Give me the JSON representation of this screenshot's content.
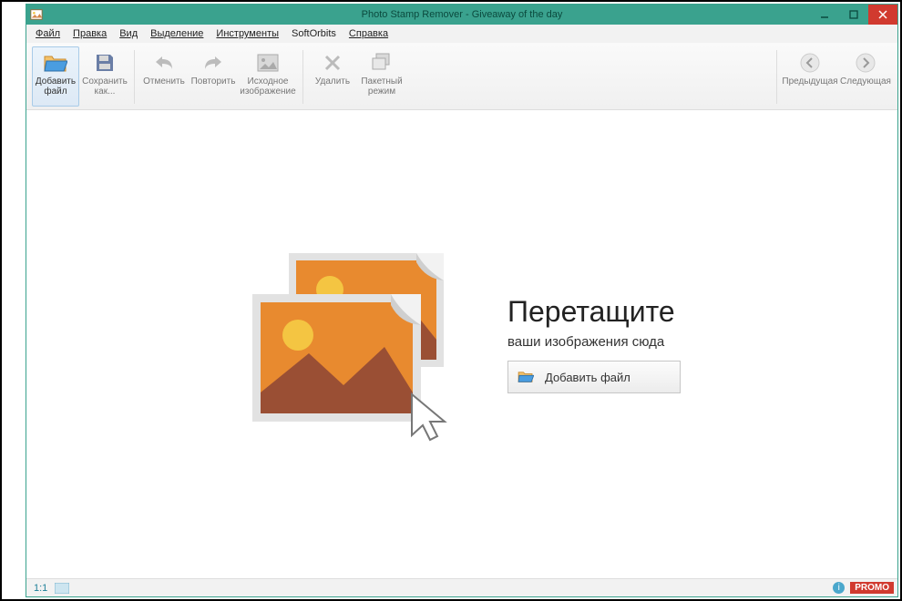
{
  "window": {
    "title": "Photo Stamp Remover - Giveaway of the day"
  },
  "menu": {
    "file": "Файл",
    "edit": "Правка",
    "view": "Вид",
    "selection": "Выделение",
    "tools": "Инструменты",
    "softorbits": "SoftOrbits",
    "help": "Справка"
  },
  "toolbar": {
    "add_file_l1": "Добавить",
    "add_file_l2": "файл",
    "save_as_l1": "Сохранить",
    "save_as_l2": "как...",
    "undo": "Отменить",
    "redo": "Повторить",
    "original_l1": "Исходное",
    "original_l2": "изображение",
    "delete": "Удалить",
    "batch_l1": "Пакетный",
    "batch_l2": "режим",
    "prev": "Предыдущая",
    "next": "Следующая"
  },
  "drop": {
    "title": "Перетащите",
    "subtitle": "ваши изображения сюда",
    "button": "Добавить файл"
  },
  "status": {
    "zoom": "1:1",
    "promo": "PROMO"
  }
}
